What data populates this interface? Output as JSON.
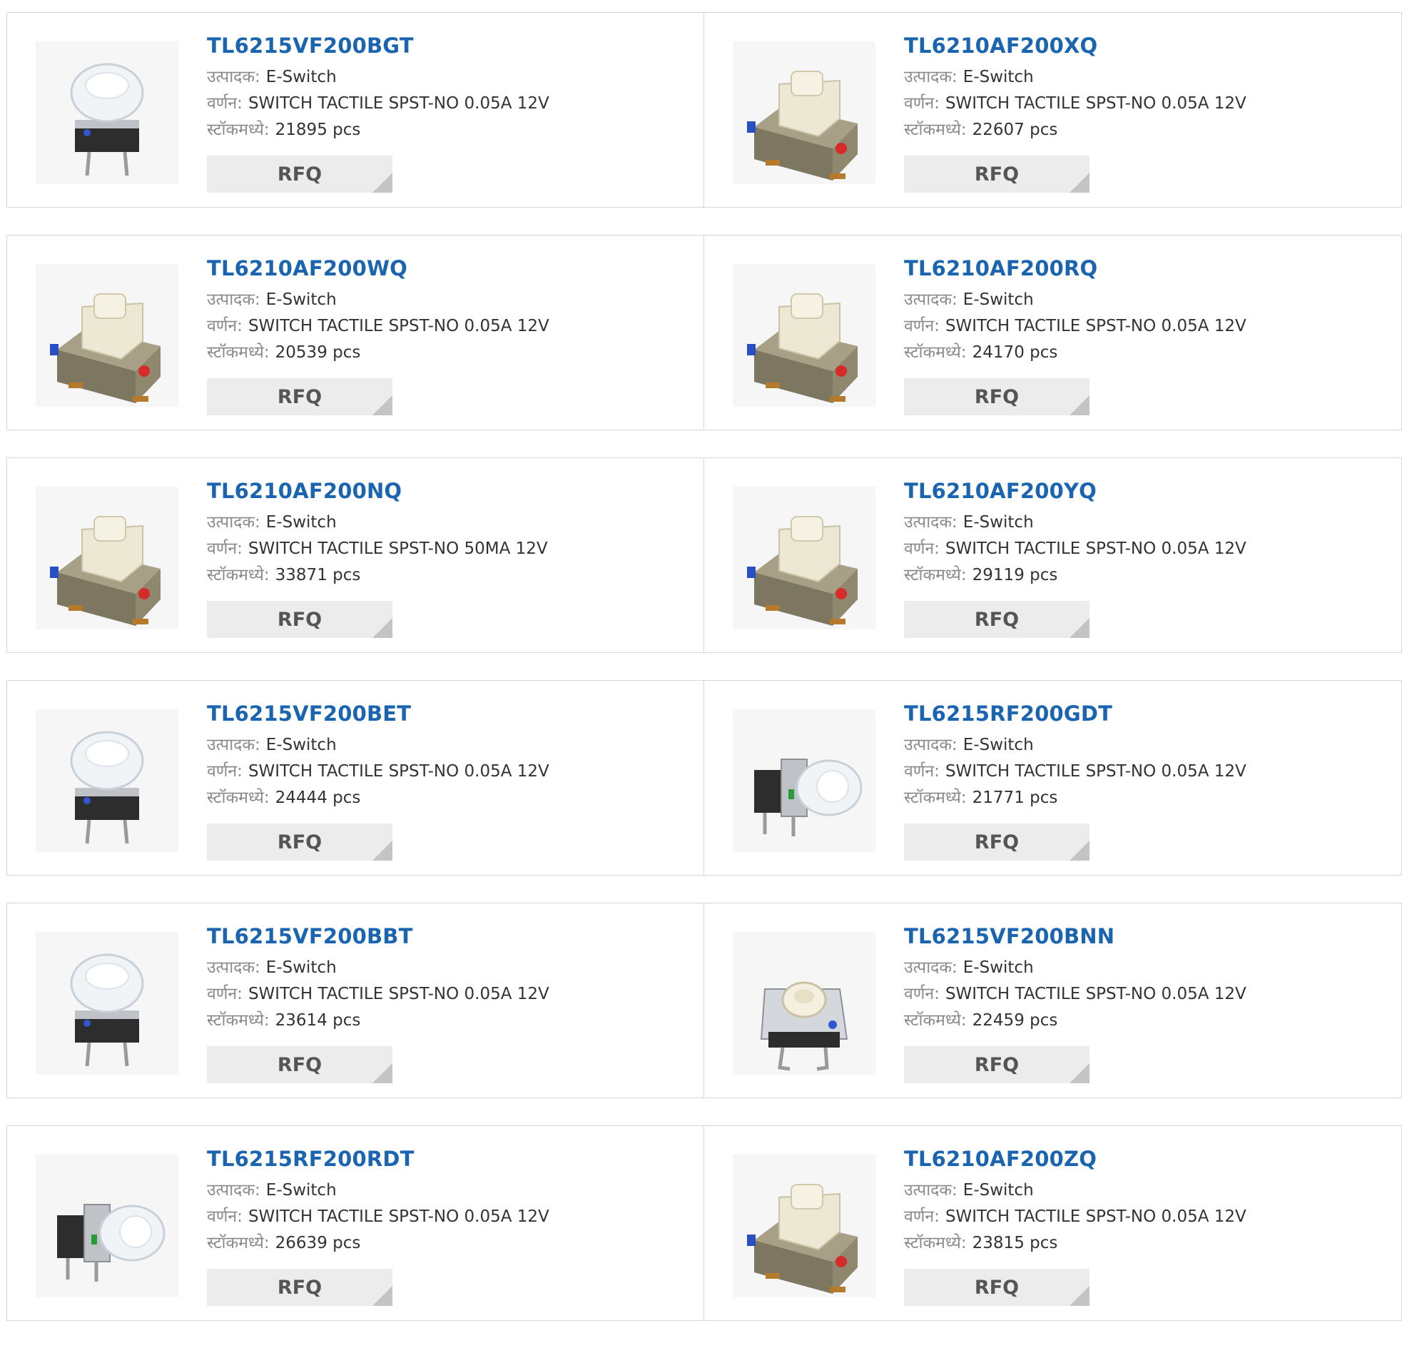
{
  "labels": {
    "manufacturer": "उत्पादक:",
    "description": "वर्णन:",
    "stock": "स्टॉकमध्ये:"
  },
  "rfq_label": "RFQ",
  "colors": {
    "title_link": "#1a64b0",
    "rfq_bg": "#ececec"
  },
  "products": [
    {
      "part": "TL6215VF200BGT",
      "manufacturer": "E-Switch",
      "description": "SWITCH TACTILE SPST-NO 0.05A 12V",
      "stock": "21895 pcs",
      "image": "illuminated-clear-cap-switch-icon"
    },
    {
      "part": "TL6210AF200XQ",
      "manufacturer": "E-Switch",
      "description": "SWITCH TACTILE SPST-NO 0.05A 12V",
      "stock": "22607 pcs",
      "image": "smd-tactile-switch-icon"
    },
    {
      "part": "TL6210AF200WQ",
      "manufacturer": "E-Switch",
      "description": "SWITCH TACTILE SPST-NO 0.05A 12V",
      "stock": "20539 pcs",
      "image": "smd-tactile-switch-icon"
    },
    {
      "part": "TL6210AF200RQ",
      "manufacturer": "E-Switch",
      "description": "SWITCH TACTILE SPST-NO 0.05A 12V",
      "stock": "24170 pcs",
      "image": "smd-tactile-switch-icon"
    },
    {
      "part": "TL6210AF200NQ",
      "manufacturer": "E-Switch",
      "description": "SWITCH TACTILE SPST-NO 50MA 12V",
      "stock": "33871 pcs",
      "image": "smd-tactile-switch-icon"
    },
    {
      "part": "TL6210AF200YQ",
      "manufacturer": "E-Switch",
      "description": "SWITCH TACTILE SPST-NO 0.05A 12V",
      "stock": "29119 pcs",
      "image": "smd-tactile-switch-icon"
    },
    {
      "part": "TL6215VF200BET",
      "manufacturer": "E-Switch",
      "description": "SWITCH TACTILE SPST-NO 0.05A 12V",
      "stock": "24444 pcs",
      "image": "illuminated-clear-cap-switch-icon"
    },
    {
      "part": "TL6215RF200GDT",
      "manufacturer": "E-Switch",
      "description": "SWITCH TACTILE SPST-NO 0.05A 12V",
      "stock": "21771 pcs",
      "image": "right-angle-illuminated-switch-icon"
    },
    {
      "part": "TL6215VF200BBT",
      "manufacturer": "E-Switch",
      "description": "SWITCH TACTILE SPST-NO 0.05A 12V",
      "stock": "23614 pcs",
      "image": "illuminated-clear-cap-switch-icon"
    },
    {
      "part": "TL6215VF200BNN",
      "manufacturer": "E-Switch",
      "description": "SWITCH TACTILE SPST-NO 0.05A 12V",
      "stock": "22459 pcs",
      "image": "through-hole-tactile-switch-icon"
    },
    {
      "part": "TL6215RF200RDT",
      "manufacturer": "E-Switch",
      "description": "SWITCH TACTILE SPST-NO 0.05A 12V",
      "stock": "26639 pcs",
      "image": "right-angle-illuminated-switch-icon"
    },
    {
      "part": "TL6210AF200ZQ",
      "manufacturer": "E-Switch",
      "description": "SWITCH TACTILE SPST-NO 0.05A 12V",
      "stock": "23815 pcs",
      "image": "smd-tactile-switch-icon"
    }
  ]
}
